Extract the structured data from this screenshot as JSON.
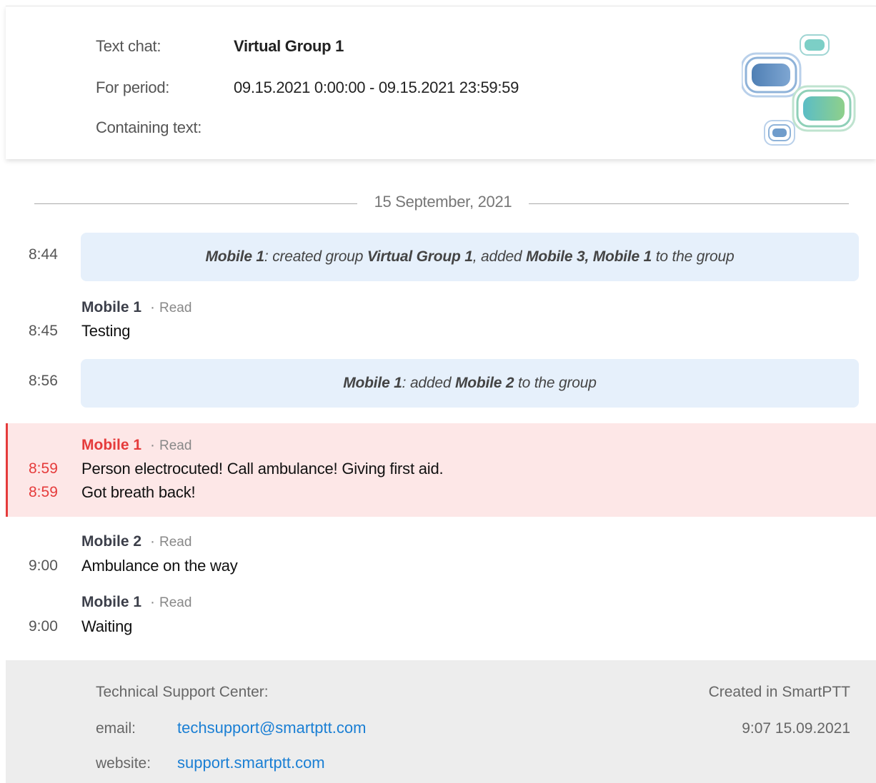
{
  "header": {
    "text_chat_label": "Text chat:",
    "text_chat_value": "Virtual Group 1",
    "period_label": "For period:",
    "period_value": "09.15.2021 0:00:00 - 09.15.2021 23:59:59",
    "containing_label": "Containing text:",
    "containing_value": ""
  },
  "date_divider": "15 September, 2021",
  "events": {
    "e1": {
      "time": "8:44",
      "actor": "Mobile 1",
      "text1": ": created group ",
      "group": "Virtual Group 1",
      "text2": ", added ",
      "members": "Mobile 3, Mobile 1",
      "text3": " to the group"
    },
    "m1": {
      "sender": "Mobile 1",
      "status": "Read",
      "time": "8:45",
      "text": "Testing"
    },
    "e2": {
      "time": "8:56",
      "actor": "Mobile 1",
      "text1": ": added ",
      "member": "Mobile 2",
      "text2": " to the group"
    },
    "m2": {
      "sender": "Mobile 1",
      "status": "Read",
      "time1": "8:59",
      "text1": "Person electrocuted! Call ambulance! Giving first aid.",
      "time2": "8:59",
      "text2": "Got breath back!"
    },
    "m3": {
      "sender": "Mobile 2",
      "status": "Read",
      "time": "9:00",
      "text": "Ambulance on the way"
    },
    "m4": {
      "sender": "Mobile 1",
      "status": "Read",
      "time": "9:00",
      "text": "Waiting"
    }
  },
  "footer": {
    "support_label": "Technical Support Center:",
    "email_label": "email:",
    "email_value": "techsupport@smartptt.com",
    "website_label": "website:",
    "website_value": "support.smartptt.com",
    "created_label": "Created in SmartPTT",
    "created_time": "9:07 15.09.2021"
  },
  "colors": {
    "alert": "#e53b3b",
    "link": "#1a7fd4",
    "system_bg": "#e6f0fb",
    "alert_bg": "#fde7e7"
  }
}
